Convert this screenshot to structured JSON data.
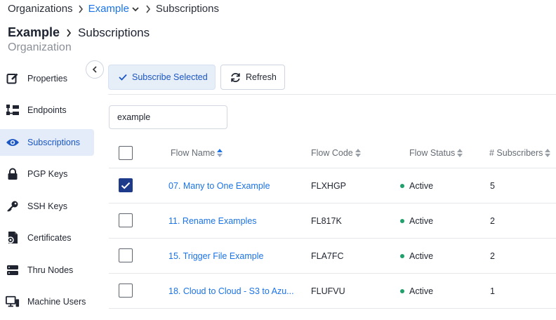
{
  "breadcrumb": {
    "items": [
      "Organizations",
      "Example",
      "Subscriptions"
    ]
  },
  "header": {
    "org": "Example",
    "section": "Subscriptions",
    "subtitle": "Organization"
  },
  "sidebar": {
    "items": [
      {
        "label": "Properties",
        "icon": "edit-icon"
      },
      {
        "label": "Endpoints",
        "icon": "endpoints-icon"
      },
      {
        "label": "Subscriptions",
        "icon": "eye-icon",
        "active": true
      },
      {
        "label": "PGP Keys",
        "icon": "lock-icon"
      },
      {
        "label": "SSH Keys",
        "icon": "key-icon"
      },
      {
        "label": "Certificates",
        "icon": "certificate-icon"
      },
      {
        "label": "Thru Nodes",
        "icon": "server-icon"
      },
      {
        "label": "Machine Users",
        "icon": "machine-user-icon"
      }
    ]
  },
  "toolbar": {
    "subscribe_label": "Subscribe Selected",
    "refresh_label": "Refresh"
  },
  "search": {
    "value": "example"
  },
  "table": {
    "headers": {
      "flow_name": "Flow Name",
      "flow_code": "Flow Code",
      "flow_status": "Flow Status",
      "subscribers": "# Subscribers"
    },
    "rows": [
      {
        "name": "07. Many to One Example",
        "code": "FLXHGP",
        "status": "Active",
        "subscribers": "5",
        "checked": true
      },
      {
        "name": "11. Rename Examples",
        "code": "FL817K",
        "status": "Active",
        "subscribers": "2",
        "checked": false
      },
      {
        "name": "15. Trigger File Example",
        "code": "FLA7FC",
        "status": "Active",
        "subscribers": "2",
        "checked": false
      },
      {
        "name": "18. Cloud to Cloud - S3 to Azu...",
        "code": "FLUFVU",
        "status": "Active",
        "subscribers": "1",
        "checked": false
      }
    ]
  },
  "colors": {
    "accent": "#1a73e8",
    "active_bg": "#e3ecf8",
    "status_active": "#22a06b",
    "checkbox_checked": "#1e3a8a"
  }
}
